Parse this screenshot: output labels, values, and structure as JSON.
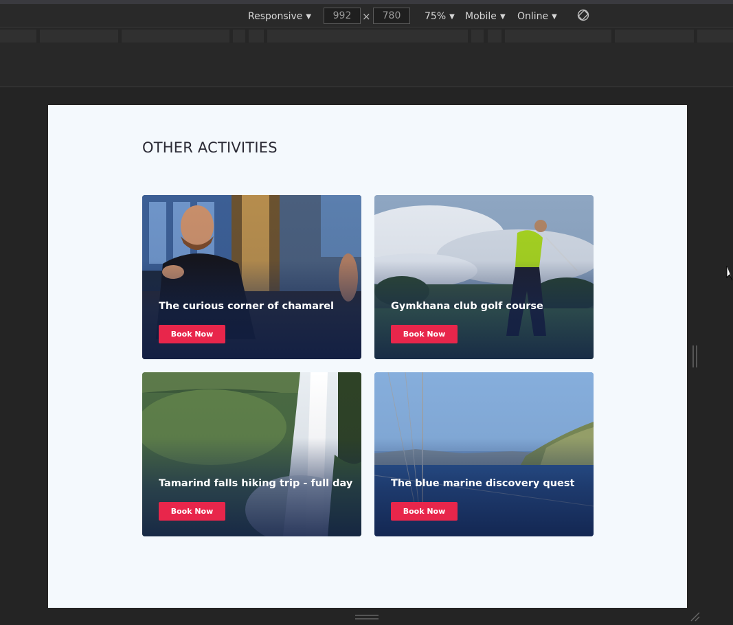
{
  "toolbar": {
    "device": "Responsive",
    "width": "992",
    "times": "×",
    "height": "780",
    "zoom": "75%",
    "device_type": "Mobile",
    "throttling": "Online",
    "rotate_icon": "rotate-icon"
  },
  "page": {
    "section_title": "OTHER ACTIVITIES",
    "cards": [
      {
        "title": "The curious corner of chamarel",
        "button": "Book Now",
        "image": "bartender-photo"
      },
      {
        "title": "Gymkhana club golf course",
        "button": "Book Now",
        "image": "golfer-photo"
      },
      {
        "title": "Tamarind falls hiking trip - full day",
        "button": "Book Now",
        "image": "waterfall-photo"
      },
      {
        "title": "The blue marine discovery quest",
        "button": "Book Now",
        "image": "sea-coast-photo"
      }
    ]
  },
  "colors": {
    "accent": "#e8264b",
    "page_bg": "#f4f9fd",
    "title_text": "#2b2b36"
  }
}
